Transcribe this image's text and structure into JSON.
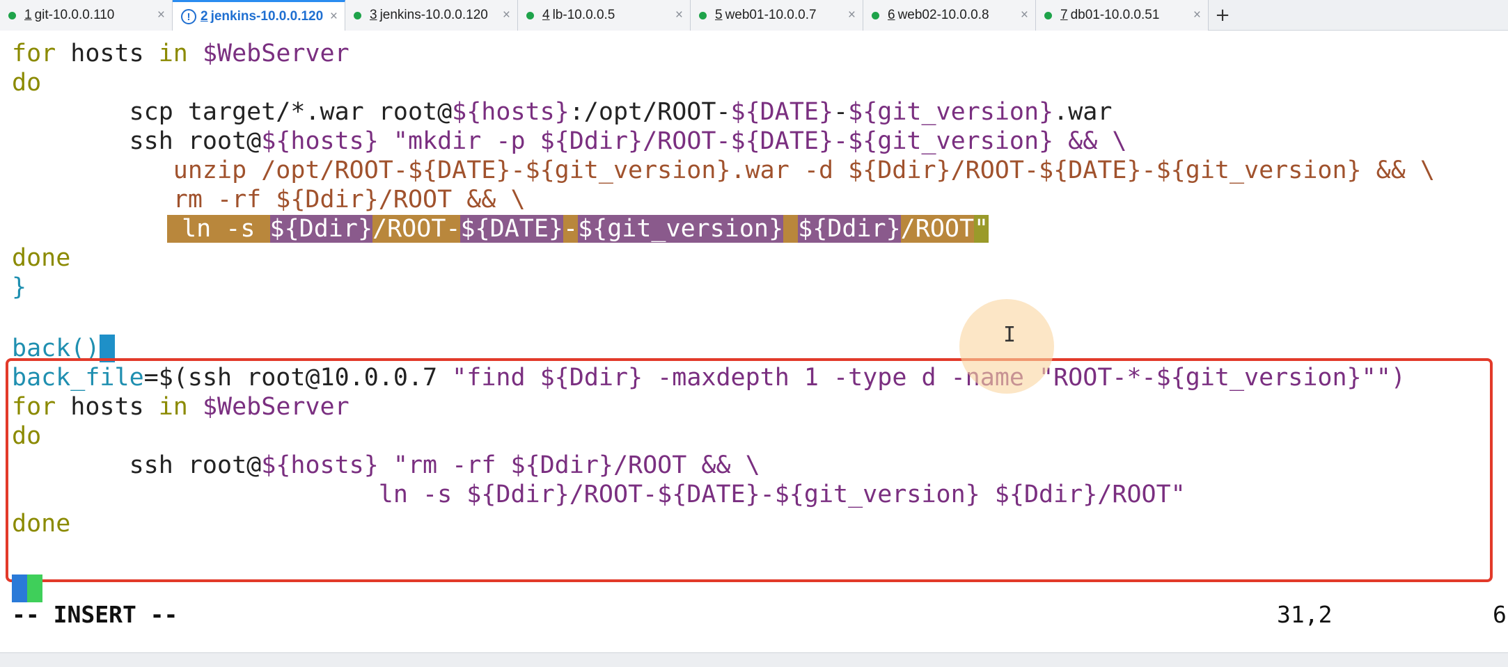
{
  "tabs": [
    {
      "number": "1",
      "label": "git-10.0.0.110",
      "active": false
    },
    {
      "number": "2",
      "label": "jenkins-10.0.0.120",
      "active": true
    },
    {
      "number": "3",
      "label": "jenkins-10.0.0.120",
      "active": false
    },
    {
      "number": "4",
      "label": "lb-10.0.0.5",
      "active": false
    },
    {
      "number": "5",
      "label": "web01-10.0.0.7",
      "active": false
    },
    {
      "number": "6",
      "label": "web02-10.0.0.8",
      "active": false
    },
    {
      "number": "7",
      "label": "db01-10.0.0.51",
      "active": false
    }
  ],
  "tab_close_glyph": "×",
  "tab_add_glyph": "+",
  "code": {
    "l1a": "for",
    "l1b": " hosts ",
    "l1c": "in",
    "l1d": " $WebServer",
    "l2": "do",
    "l3a": "        scp target/*.war root@",
    "l3b": "${hosts}",
    "l3c": ":/opt/ROOT-",
    "l3d": "${DATE}",
    "l3e": "-",
    "l3f": "${git_version}",
    "l3g": ".war",
    "l4a": "        ssh root@",
    "l4b": "${hosts}",
    "l4c": " \"mkdir -p ${Ddir}/ROOT-${DATE}-${git_version} && \\",
    "l5": "           unzip /opt/ROOT-${DATE}-${git_version}.war -d ${Ddir}/ROOT-${DATE}-${git_version} && \\",
    "l6": "           rm -rf ${Ddir}/ROOT && \\",
    "l7a": " ln -s ",
    "l7b": "${Ddir}",
    "l7c": "/ROOT-",
    "l7d": "${DATE}",
    "l7e": "-",
    "l7f": "${git_version}",
    "l7g": " ",
    "l7h": "${Ddir}",
    "l7i": "/ROOT",
    "l7j": "\"",
    "l8": "done",
    "l9": "}",
    "l11": "back()",
    "l11cursor": "{",
    "l12a": "back_file",
    "l12b": "=$(ssh root@10.0.0.7 ",
    "l12c": "\"find ${Ddir} -maxdepth 1 -type d -name \"ROOT-*-${git_version}\"\")",
    "l13a": "for",
    "l13b": " hosts ",
    "l13c": "in",
    "l13d": " $WebServer",
    "l14": "do",
    "l15a": "        ssh root@",
    "l15b": "${hosts}",
    "l15c": " \"rm -rf ${Ddir}/ROOT && \\",
    "l16": "                         ln -s ${Ddir}/ROOT-${DATE}-${git_version} ${Ddir}/ROOT\"",
    "l17": "done"
  },
  "status": {
    "mode": "-- INSERT --",
    "position": "31,2",
    "percent": "6"
  },
  "colors": {
    "accent_tab": "#2a8cf0",
    "selection_box": "#e23a2a",
    "keyword": "#8b8a00",
    "string": "#7a2f80"
  }
}
